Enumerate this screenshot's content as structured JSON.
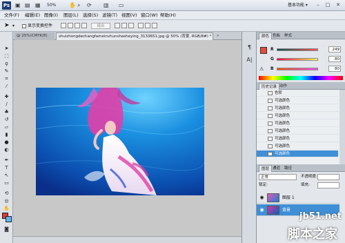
{
  "app": {
    "logo": "Ps",
    "zoom": "50%",
    "workspace": "基本功能 ▾",
    "window_controls": [
      "–",
      "□",
      "✕"
    ]
  },
  "menubar": {
    "items": [
      "文件(F)",
      "编辑(E)",
      "图像(I)",
      "图层(L)",
      "选择(S)",
      "滤镜(T)",
      "视图(V)",
      "窗口(W)",
      "帮助(H)"
    ]
  },
  "options_bar": {
    "checkbox_label": "显示变换控件",
    "field_placeholder": "组合"
  },
  "document_tabs": {
    "tab1": "@ 25%(CMYK/8)",
    "tab2": "shuizhongdechangfameinvhunshasheying_3133651.jpg @ 50% (背景, RGB/8#) *",
    "more": "»"
  },
  "color_panel": {
    "tabs": [
      "颜色",
      "色板",
      "样式"
    ],
    "r": "249",
    "g": "80",
    "b": "80",
    "r_letter": "R",
    "g_letter": "G",
    "b_letter": "B"
  },
  "history_panel": {
    "tabs": [
      "历史记录",
      "动作"
    ],
    "items": [
      "色阶",
      "可选颜色",
      "可选颜色",
      "可选颜色",
      "可选颜色",
      "可选颜色",
      "可选颜色",
      "可选颜色",
      "可选颜色"
    ]
  },
  "layers_panel": {
    "tabs": [
      "图层",
      "通道",
      "路径"
    ],
    "blend_mode": "正常",
    "opacity_label": "不透明度:",
    "lock_label": "锁定:",
    "fill_label": "填充:",
    "layers": [
      "图层 1",
      "背景"
    ]
  },
  "watermark": {
    "line1": "jb51.net",
    "line2": "脚本之家"
  },
  "colors": {
    "accent": "#3f8fd6",
    "foreground": "#e6493f",
    "background_swatch": "#5fb6f0"
  }
}
